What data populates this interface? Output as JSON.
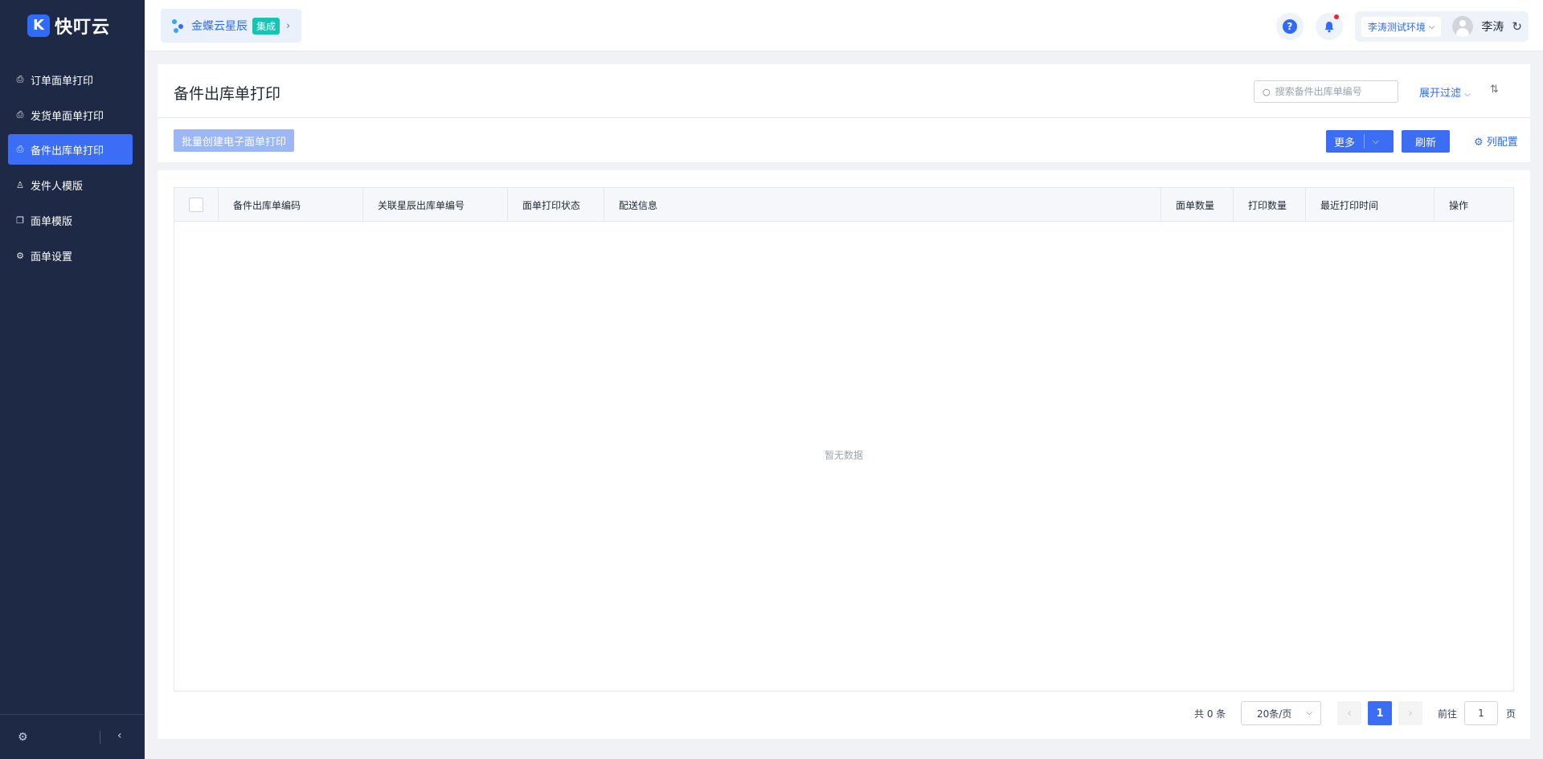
{
  "brand": {
    "name": "快叮云",
    "mark": "K"
  },
  "app_switch": {
    "name": "金蝶云星辰",
    "tag": "集成"
  },
  "header": {
    "help_symbol": "?",
    "environment": "李涛测试环境",
    "user": "李涛"
  },
  "sidebar": {
    "items": [
      {
        "label": "订单面单打印",
        "icon": "printer-icon",
        "active": false
      },
      {
        "label": "发货单面单打印",
        "icon": "printer-icon",
        "active": false
      },
      {
        "label": "备件出库单打印",
        "icon": "printer-icon",
        "active": true
      },
      {
        "label": "发件人模版",
        "icon": "person-icon",
        "active": false
      },
      {
        "label": "面单模版",
        "icon": "document-icon",
        "active": false
      },
      {
        "label": "面单设置",
        "icon": "settings-icon",
        "active": false
      }
    ],
    "footer": {
      "settings_icon": "gear-icon",
      "collapse_icon": "chevron-left-icon"
    }
  },
  "page": {
    "title": "备件出库单打印",
    "search_placeholder": "搜索备件出库单编号",
    "filter_label": "展开过滤",
    "toolbar": {
      "batch_label": "批量创建电子面单打印",
      "more_label": "更多",
      "refresh_label": "刷新",
      "columns_label": "列配置"
    }
  },
  "table": {
    "columns": [
      "备件出库单编码",
      "关联星辰出库单编号",
      "面单打印状态",
      "配送信息",
      "面单数量",
      "打印数量",
      "最近打印时间",
      "操作"
    ],
    "rows": [],
    "empty_text": "暂无数据"
  },
  "pagination": {
    "total_text": "共 0 条",
    "page_size": "20条/页",
    "current_page": "1",
    "goto_label": "前往",
    "goto_value": "1",
    "page_suffix": "页"
  },
  "colors": {
    "sidebar_bg": "#1e2a45",
    "accent": "#3b6ef5",
    "link": "#2f6bff",
    "tag": "#17c4b4"
  }
}
